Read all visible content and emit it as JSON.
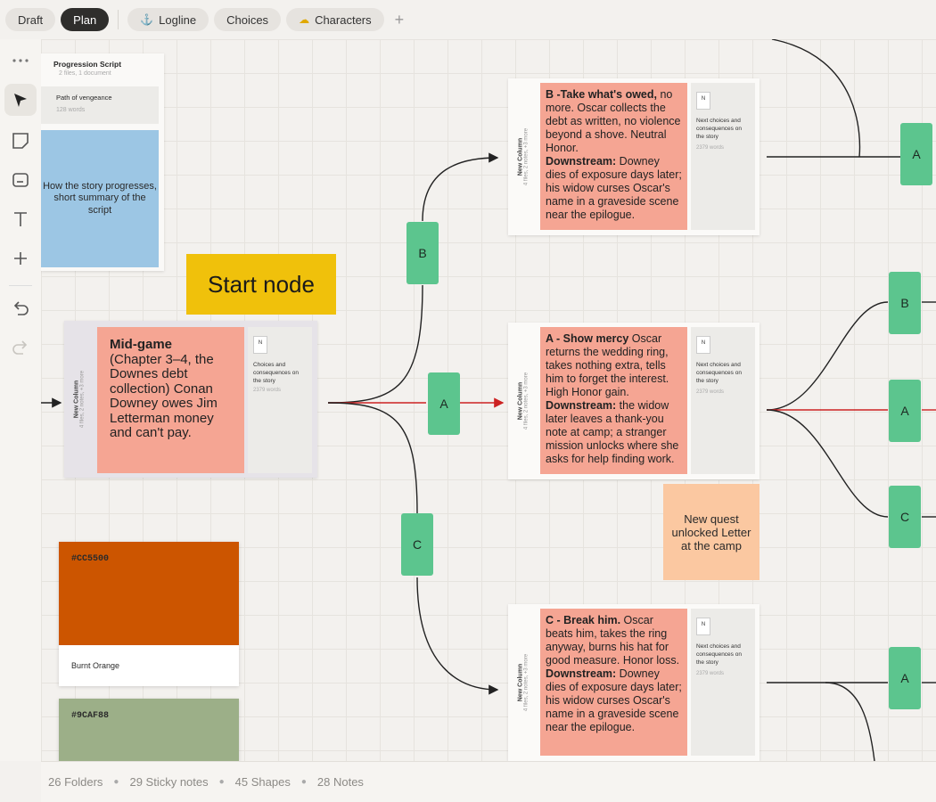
{
  "top_tabs": {
    "draft": "Draft",
    "plan": "Plan",
    "logline": "Logline",
    "choices": "Choices",
    "characters": "Characters"
  },
  "script_card": {
    "title": "Progression  Script",
    "meta": "2 files, 1 document",
    "doc_title": "Path of vengeance",
    "doc_words": "128 words",
    "sticky": "How the story progresses, short summary of the script"
  },
  "start_label": "Start node",
  "columns": {
    "label": "New Column",
    "meta": "4 files, 2 notes, +3 more"
  },
  "doc": {
    "text": "Choices and consequences on the story",
    "words": "2379 words"
  },
  "alt_doc": {
    "text": "Next choices and consequences on the story",
    "words": "2379 words"
  },
  "midgame": {
    "heading": "Mid-game",
    "body": "(Chapter 3–4, the Downes debt collection) Conan Downey owes Jim Letterman money and can't pay."
  },
  "note_b": {
    "heading": "B -Take what's owed,",
    "body": " no more. Oscar collects the debt as written, no violence beyond a shove. Neutral Honor.",
    "down_label": "Downstream:",
    "down_body": " Downey dies of exposure days later; his widow curses Oscar's name in a graveside scene near the epilogue."
  },
  "note_a": {
    "heading": "A - Show mercy",
    "body": " Oscar returns the wedding ring, takes nothing extra, tells him to forget the interest. High Honor gain.",
    "down_label": "Downstream:",
    "down_body": " the widow later leaves a thank-you note at camp; a stranger mission unlocks where she asks for help finding work."
  },
  "note_c": {
    "heading": "C - Break him.",
    "body": " Oscar beats him, takes the ring anyway, burns his hat for good measure. Honor loss.",
    "down_label": "Downstream:",
    "down_body": " Downey dies of exposure days later; his widow curses Oscar's name in a graveside scene near the epilogue."
  },
  "quest_note": "New quest unlocked Letter at the camp",
  "branches": {
    "a": "A",
    "b": "B",
    "c": "C"
  },
  "swatches": [
    {
      "hex": "#CC5500",
      "name": "Burnt Orange"
    },
    {
      "hex": "#9CAF88",
      "name": ""
    }
  ],
  "stats": {
    "folders": "26 Folders",
    "sticky": "29 Sticky notes",
    "shapes": "45 Shapes",
    "notes": "28 Notes"
  },
  "colors": {
    "branch": "#5cc58e",
    "note": "#f5a593",
    "sticky_blue": "#9cc6e4",
    "start": "#f0c10b",
    "quest": "#fbc8a1",
    "accent_red": "#cc2222"
  }
}
